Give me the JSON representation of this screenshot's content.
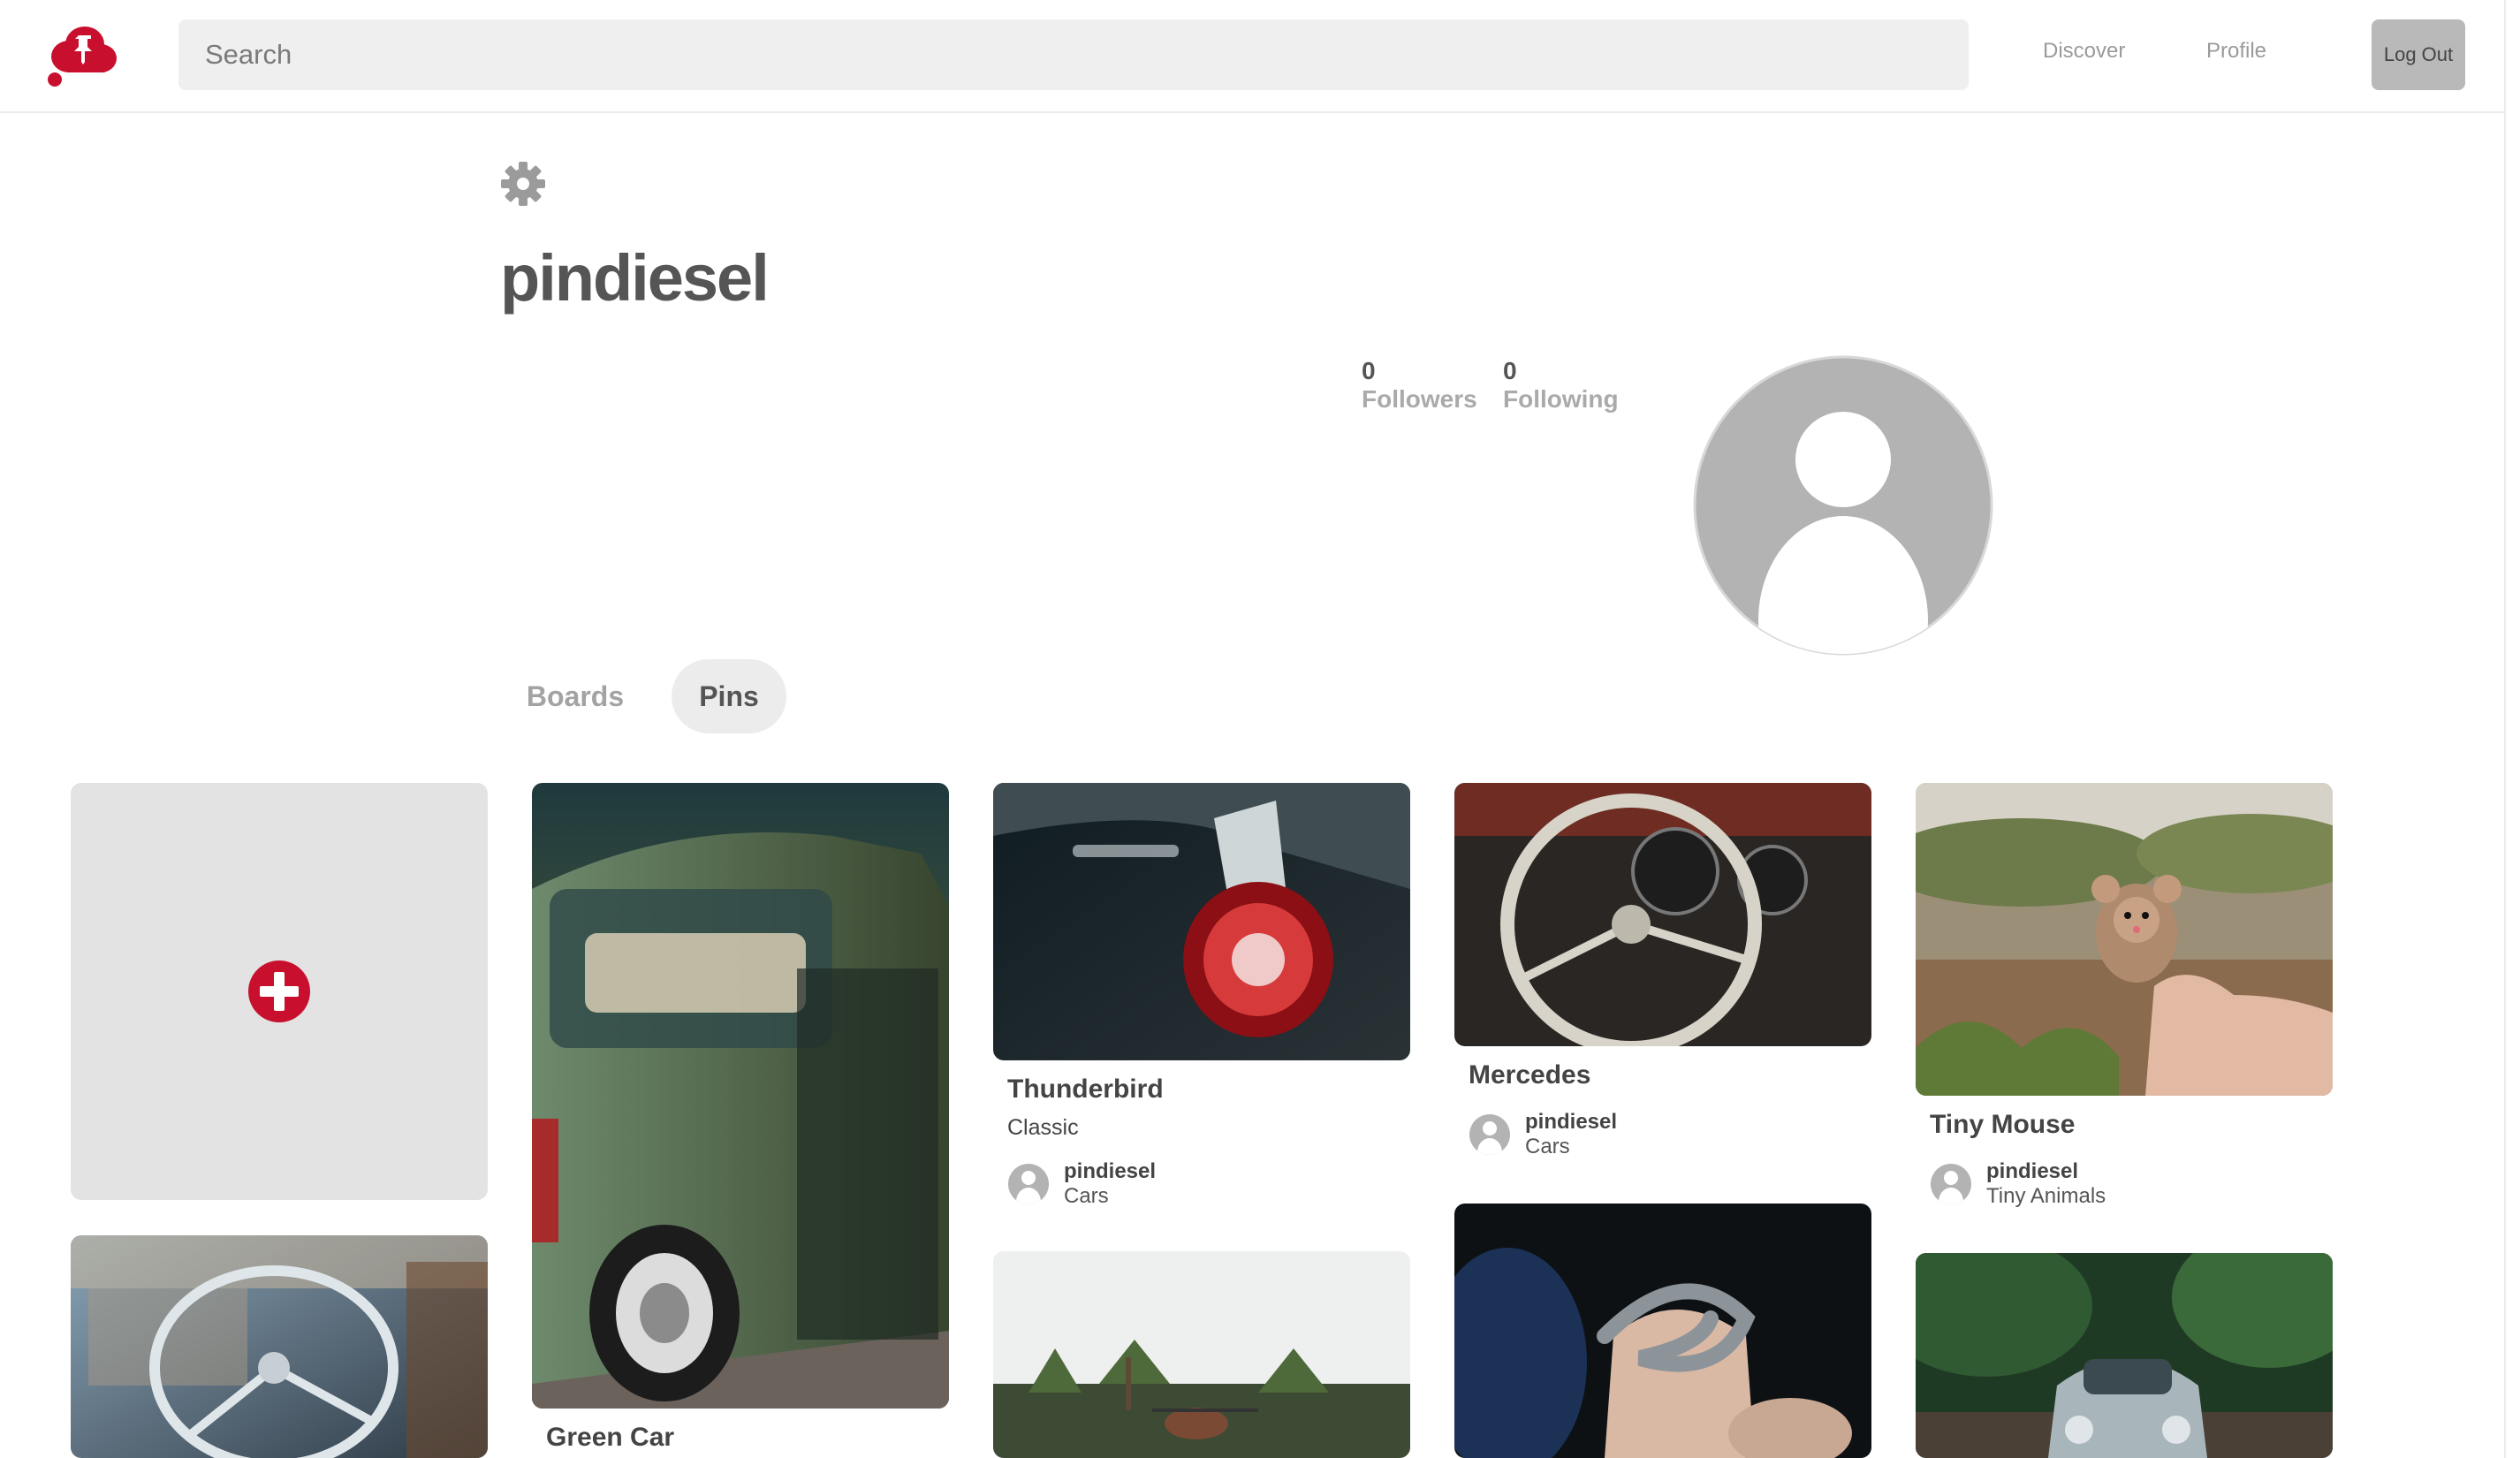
{
  "header": {
    "search_placeholder": "Search",
    "nav": {
      "discover": "Discover",
      "profile": "Profile",
      "logout": "Log Out"
    },
    "brand_color": "#c8102e"
  },
  "profile": {
    "username": "pindiesel",
    "followers_count": "0",
    "followers_label": "Followers",
    "following_count": "0",
    "following_label": "Following"
  },
  "tabs": [
    {
      "label": "Boards",
      "active": false
    },
    {
      "label": "Pins",
      "active": true
    }
  ],
  "pins": [
    {
      "title": "Green Car",
      "description": "",
      "user": "",
      "board": ""
    },
    {
      "title": "Thunderbird",
      "description": "Classic",
      "user": "pindiesel",
      "board": "Cars"
    },
    {
      "title": "Mercedes",
      "description": "",
      "user": "pindiesel",
      "board": "Cars"
    },
    {
      "title": "Tiny Mouse",
      "description": "",
      "user": "pindiesel",
      "board": "Tiny Animals"
    }
  ],
  "colors": {
    "avatar_gray": "#b3b3b3",
    "add_card_bg": "#e3e3e3",
    "accent": "#c8102e"
  }
}
